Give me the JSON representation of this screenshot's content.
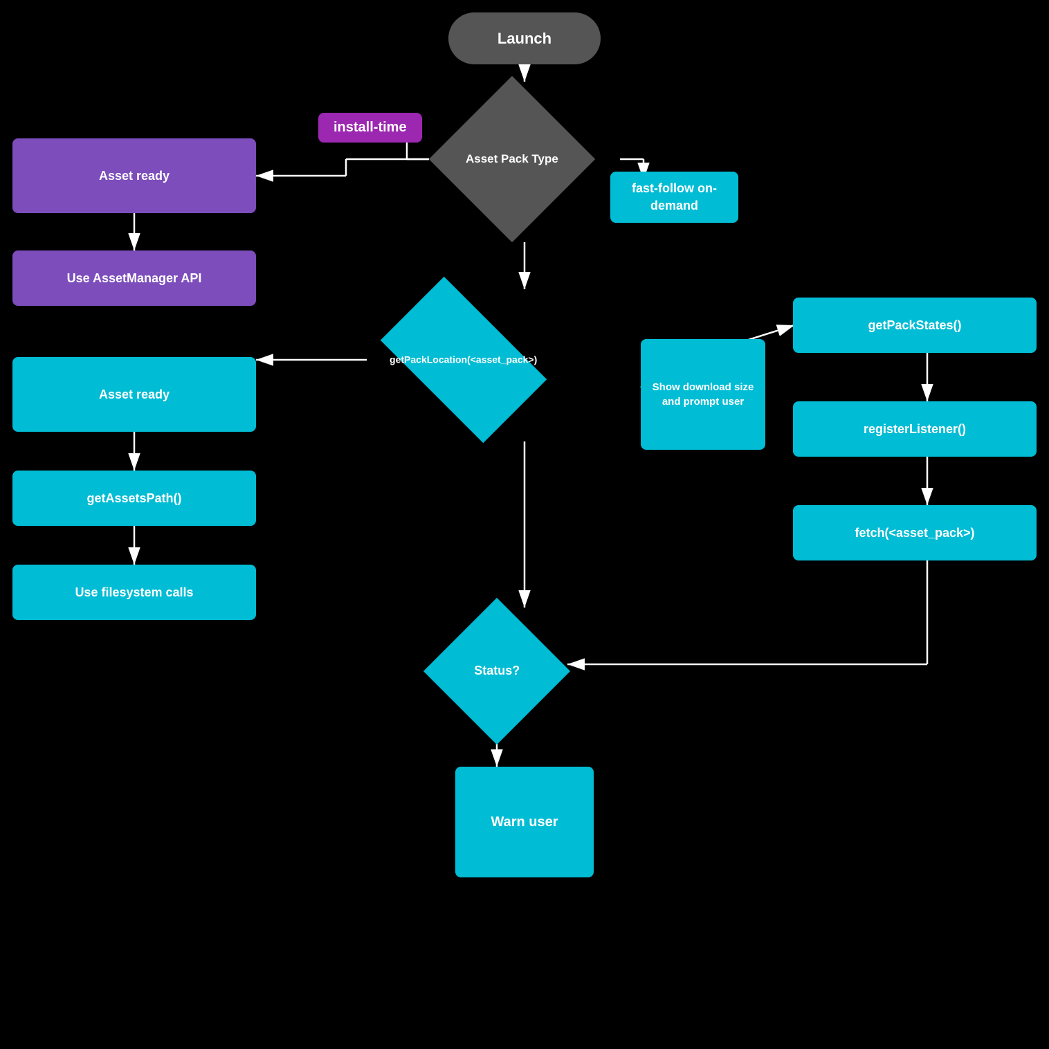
{
  "nodes": {
    "launch": "Launch",
    "install_time": "install-time",
    "asset_pack_type": "Asset Pack\nType",
    "fast_follow": "fast-follow\non-demand",
    "asset_ready_1": "Asset ready",
    "use_assetmanager": "Use AssetManager API",
    "asset_ready_2": "Asset ready",
    "get_assets_path": "getAssetsPath()",
    "use_filesystem": "Use filesystem calls",
    "pack_location": "getPackLocation(<asset_pack>)",
    "show_download": "Show download size and prompt user",
    "get_pack_states": "getPackStates()",
    "register_listener": "registerListener()",
    "fetch": "fetch(<asset_pack>)",
    "status": "Status?",
    "warn_user": "Warn user"
  }
}
